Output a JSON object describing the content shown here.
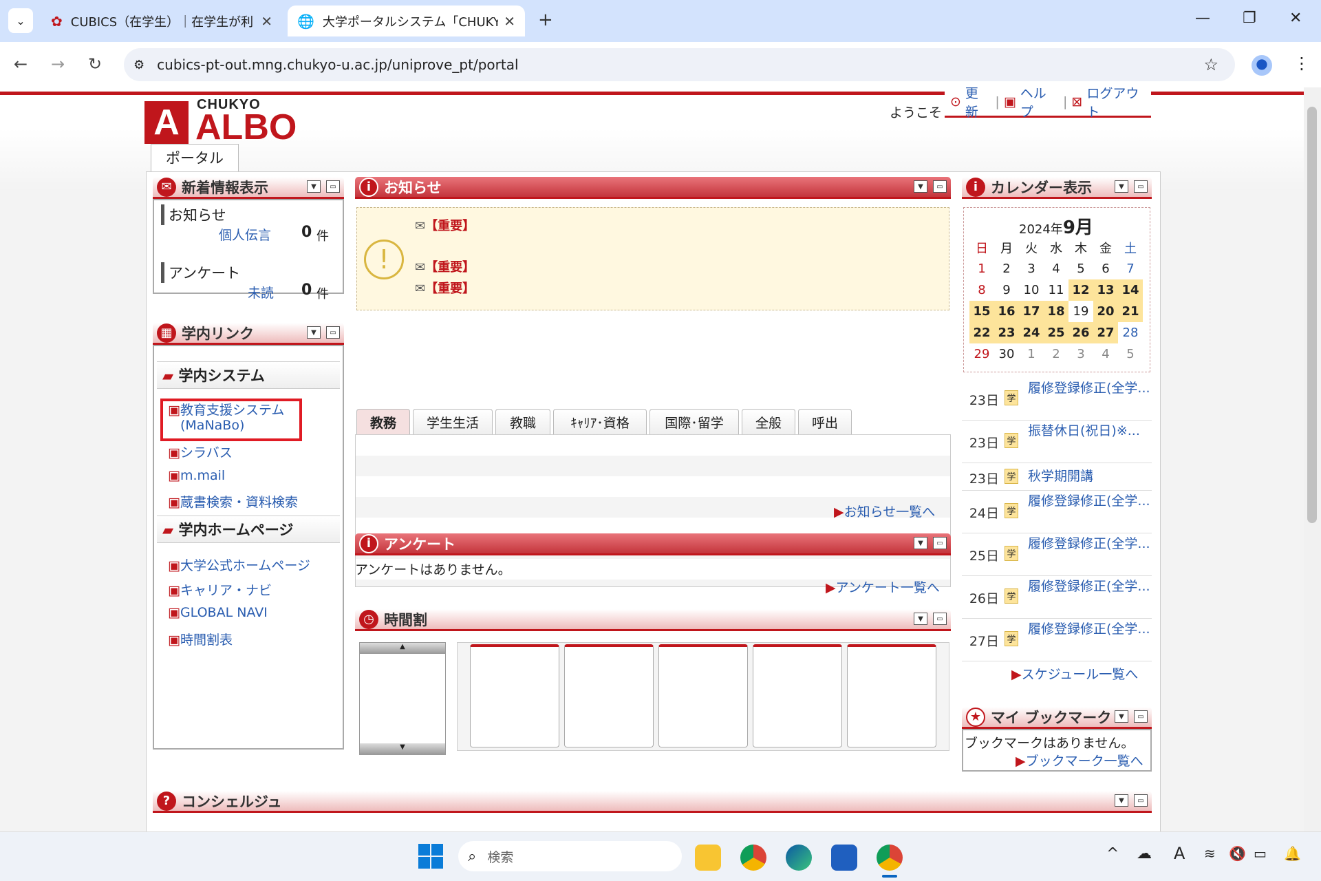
{
  "browser": {
    "tabs": [
      {
        "title": "CUBICS（在学生）｜在学生が利"
      },
      {
        "title": "大学ポータルシステム「CHUKYO AL"
      }
    ],
    "url": "cubics-pt-out.mng.chukyo-u.ac.jp/uniprove_pt/portal"
  },
  "header": {
    "logo_top": "CHUKYO",
    "logo_main": "ALBO",
    "welcome": "ようこそ",
    "refresh": "更新",
    "help": "ヘルプ",
    "logout": "ログアウト",
    "portal_tab": "ポータル"
  },
  "news": {
    "title": "新着情報表示",
    "notice": "お知らせ",
    "personal": "個人伝言",
    "personal_count": "0",
    "unit": "件",
    "survey": "アンケート",
    "unread": "未読",
    "unread_count": "0"
  },
  "links": {
    "title": "学内リンク",
    "sys_title": "学内システム",
    "sys": [
      "教育支援システム",
      "(MaNaBo)",
      "シラバス",
      "m.mail",
      "蔵書検索・資料検索"
    ],
    "hp_title": "学内ホームページ",
    "hp": [
      "大学公式ホームページ",
      "キャリア・ナビ",
      "GLOBAL NAVI",
      "時間割表"
    ]
  },
  "notice": {
    "title": "お知らせ",
    "items": [
      "【重要】",
      "【重要】",
      "【重要】"
    ],
    "tabs": [
      "教務",
      "学生生活",
      "教職",
      "ｷｬﾘｱ･資格",
      "国際･留学",
      "全般",
      "呼出"
    ],
    "more": "お知らせ一覧へ"
  },
  "survey": {
    "title": "アンケート",
    "empty": "アンケートはありません。",
    "more": "アンケート一覧へ"
  },
  "timetable": {
    "title": "時間割"
  },
  "calendar": {
    "title": "カレンダー表示",
    "year": "2024年",
    "month": "9月",
    "weekdays": [
      "日",
      "月",
      "火",
      "水",
      "木",
      "金",
      "土"
    ],
    "rows": [
      [
        "1",
        "2",
        "3",
        "4",
        "5",
        "6",
        "7"
      ],
      [
        "8",
        "9",
        "10",
        "11",
        "12",
        "13",
        "14"
      ],
      [
        "15",
        "16",
        "17",
        "18",
        "19",
        "20",
        "21"
      ],
      [
        "22",
        "23",
        "24",
        "25",
        "26",
        "27",
        "28"
      ],
      [
        "29",
        "30",
        "1",
        "2",
        "3",
        "4",
        "5"
      ]
    ],
    "schedule": [
      {
        "d": "23日",
        "b": "学",
        "t": "履修登録修正(全学..."
      },
      {
        "d": "23日",
        "b": "学",
        "t": "振替休日(祝日)※..."
      },
      {
        "d": "23日",
        "b": "学",
        "t": "秋学期開講"
      },
      {
        "d": "24日",
        "b": "学",
        "t": "履修登録修正(全学..."
      },
      {
        "d": "25日",
        "b": "学",
        "t": "履修登録修正(全学..."
      },
      {
        "d": "26日",
        "b": "学",
        "t": "履修登録修正(全学..."
      },
      {
        "d": "27日",
        "b": "学",
        "t": "履修登録修正(全学..."
      }
    ],
    "more": "スケジュール一覧へ"
  },
  "bookmark": {
    "title": "マイ ブックマーク",
    "empty": "ブックマークはありません。",
    "more": "ブックマーク一覧へ"
  },
  "concierge": {
    "title": "コンシェルジュ"
  },
  "taskbar": {
    "search": "検索"
  },
  "colors": {
    "brand_red": "#c0161c",
    "highlight": "#fde49b",
    "link": "#2a5db0"
  }
}
